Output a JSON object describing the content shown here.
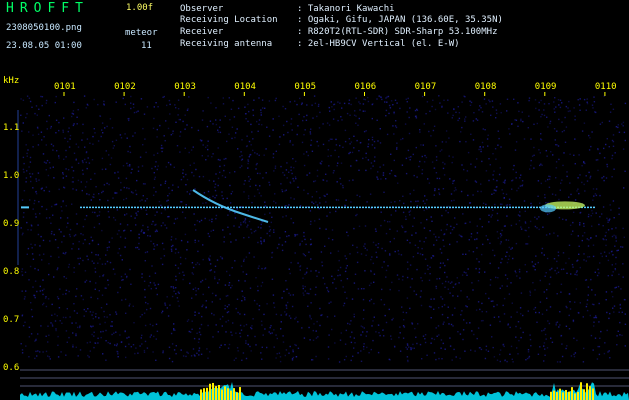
{
  "header": {
    "app_title": "HROFFT",
    "version": "1.00f",
    "filename": "2308050100.png",
    "datetime": "23.08.05 01:00",
    "meteor_label": "meteor",
    "meteor_count": "11"
  },
  "station": [
    {
      "label": "Observer",
      "value": ": Takanori Kawachi"
    },
    {
      "label": "Receiving Location",
      "value": ": Ogaki, Gifu, JAPAN (136.60E, 35.35N)"
    },
    {
      "label": "Receiver",
      "value": ": R820T2(RTL-SDR) SDR-Sharp 53.100MHz"
    },
    {
      "label": "Receiving antenna",
      "value": ": 2el-HB9CV Vertical (el. E-W)"
    }
  ],
  "chart_data": {
    "type": "heatmap",
    "ylabel": "kHz",
    "x_ticks": [
      "0101",
      "0102",
      "0103",
      "0104",
      "0105",
      "0106",
      "0107",
      "0108",
      "0109",
      "0110"
    ],
    "y_ticks": [
      "1.1",
      "1.0",
      "0.9",
      "0.8",
      "0.7",
      "0.6"
    ],
    "ylim": [
      0.58,
      1.17
    ],
    "carrier_khz": 0.935,
    "colors": {
      "background": "#000000",
      "noise": "#1a1a8c",
      "carrier": "#55ccff",
      "meteor": "#ccff66",
      "tick_label": "#ffff00",
      "baseline": "#00e5ff"
    }
  }
}
